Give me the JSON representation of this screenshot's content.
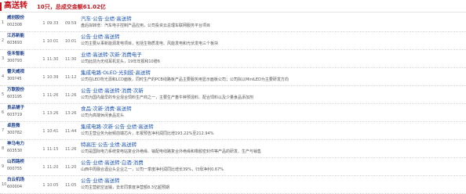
{
  "header": {
    "title": "高送转",
    "summary": "10只，总成交金额61.02亿"
  },
  "rows": [
    {
      "index": "1",
      "name": "威创股份",
      "code": "002308",
      "boards": "1",
      "first_time": "09:33",
      "last_time": "09:59",
      "tags": "汽车·公告·业绩·高送转",
      "desc": "盘后拟转增：汽车电子控制产品应用，公司投资云总理车联网服务平台项目"
    },
    {
      "index": "2",
      "name": "江苏新能",
      "code": "603693",
      "boards": "1",
      "first_time": "10:01",
      "last_time": "10:01",
      "tags": "公告·业绩·高送转",
      "desc": "公司主要从事新能源发电项目，包括生物质发电、风能发电和光伏发电三个板块"
    },
    {
      "index": "3",
      "name": "佳禾智能",
      "code": "300793",
      "boards": "1",
      "first_time": "11:30",
      "last_time": "11:30",
      "tags": "业绩·高送转·次新·消费电子",
      "desc": "公司此前为无线耳机龙头，19年年报和10赠6"
    },
    {
      "index": "4",
      "name": "雷天威视",
      "code": "300?45",
      "boards": "1",
      "first_time": "10:39",
      "last_time": "11:12",
      "tags": "集成电路·OLED·光刻胶·高送转",
      "desc": "公司在LED背光源和LCD面板，同时生产的PCB线路板产品主要服务用显示面板公司；公司拟以MiniLED为主要研发方向"
    },
    {
      "index": "5",
      "name": "万联股份",
      "code": "603195",
      "boards": "1",
      "first_time": "11:26",
      "last_time": "11:26",
      "tags": "公告·业绩·高送转·消费·次新",
      "desc": "公司为国内最早的专业混合饲料生产商之一，主要生产畜牛种预混料、配合饲料以及少量食品添加剂"
    },
    {
      "index": "6",
      "name": "良品铺子",
      "code": "603719",
      "boards": "1",
      "first_time": "13:26",
      "last_time": "13:26",
      "tags": "食品·次新·消费·高送转",
      "desc": "公司为高端休闲食品龙头"
    },
    {
      "index": "7",
      "name": "卓胜微",
      "code": "300782",
      "boards": "1",
      "first_time": "10:41",
      "last_time": "11:44",
      "tags": "集成电路·次新·公告·业绩·高送转",
      "desc": "公司主营业务为射频前端芯片，年报预告净利润同比增193.22%至212.94%"
    },
    {
      "index": "8",
      "name": "神马电力",
      "code": "603530",
      "boards": "1",
      "first_time": "11:15",
      "last_time": "11:26",
      "tags": "特高压·公告·业绩·高送转",
      "desc": "公司是国际电力系统变电站复合外绝缘、输配电线路复合外绝缘和橡胶密封件等产品的研发、生产与销售"
    },
    {
      "index": "9",
      "name": "山西路桥",
      "code": "000755",
      "boards": "1",
      "first_time": "11:20",
      "last_time": "11:20",
      "tags": "公告·业绩·高送转·白酒·消费",
      "desc": "山西中周融合酒业头企业之一，公司一季度净利润同比增长39%，归母净利0.67%"
    },
    {
      "index": "10",
      "name": "白云机场",
      "code": "600004",
      "boards": "1",
      "first_time": "10:05",
      "last_time": "11:05",
      "tags": "公告·业绩·高送转",
      "desc": "公司主营航空运输，去年同季度净营额8.3亿超预期"
    }
  ]
}
